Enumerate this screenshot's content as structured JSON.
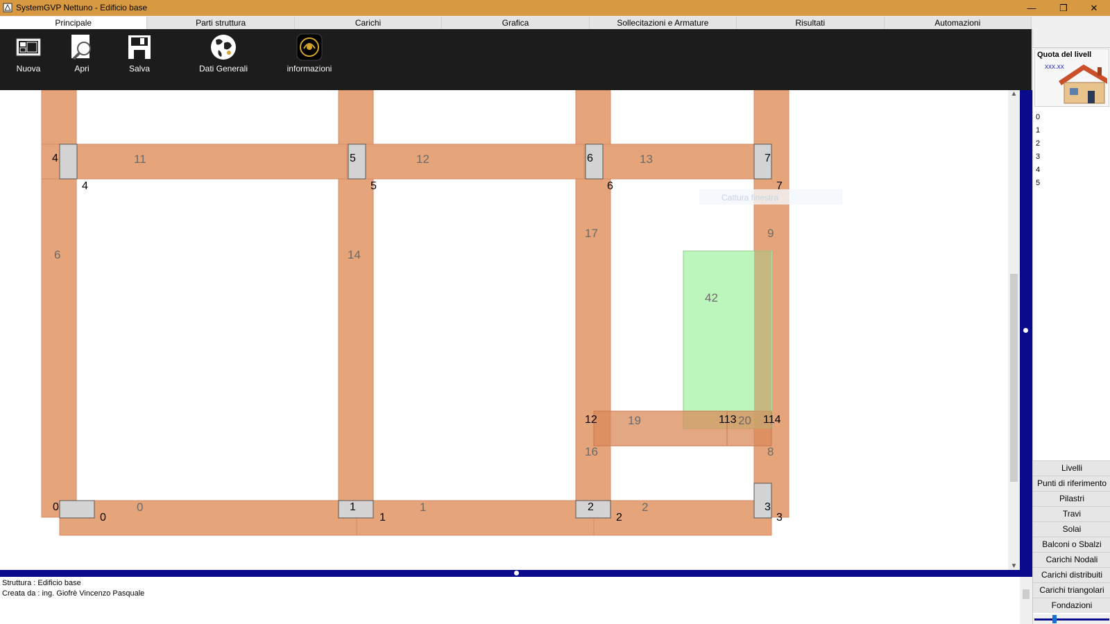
{
  "window": {
    "title": "SystemGVP Nettuno - Edificio base",
    "minimize": "—",
    "maximize": "❐",
    "close": "✕"
  },
  "tabs": [
    "Principale",
    "Parti struttura",
    "Carichi",
    "Grafica",
    "Sollecitazioni e Armature",
    "Risultati",
    "Automazioni"
  ],
  "active_tab": "Principale",
  "toolbar": {
    "nuova": "Nuova",
    "apri": "Apri",
    "salva": "Salva",
    "dati_generali": "Dati Generali",
    "informazioni": "informazioni"
  },
  "drawing": {
    "beam_labels": {
      "b11": "11",
      "b12": "12",
      "b13": "13",
      "b6": "6",
      "b14": "14",
      "b17": "17",
      "b9": "9",
      "b16": "16",
      "b8": "8",
      "b19": "19",
      "b20": "20",
      "b0": "0",
      "b1": "1",
      "b2": "2"
    },
    "node_labels": {
      "n4": "4",
      "n5": "5",
      "n6": "6",
      "n7": "7",
      "n0": "0",
      "n1": "1",
      "n2": "2",
      "n3": "3",
      "n12": "12",
      "n113": "113",
      "n114": "114"
    },
    "pillar_labels": {
      "p4": "4",
      "p5": "5",
      "p6": "6",
      "p7": "7",
      "p0": "0",
      "p1": "1",
      "p2": "2",
      "p3": "3"
    },
    "slab_label": "42",
    "capture_tooltip": "Cattura finestra",
    "colors": {
      "beam": "#e5a47a",
      "beam_edge": "#d88a63",
      "pillar": "#d3d3d3",
      "slab": "#b9f5b9"
    }
  },
  "console": {
    "line1": "Struttura : Edificio base",
    "line2": "Creata da : ing. Giofrè Vincenzo Pasquale"
  },
  "right_panel": {
    "header_title": "Quota del livell",
    "header_sub": "xxx.xx",
    "levels": [
      "0",
      "1",
      "2",
      "3",
      "4",
      "5"
    ],
    "buttons": [
      "Livelli",
      "Punti di riferimento",
      "Pilastri",
      "Travi",
      "Solai",
      "Balconi o Sbalzi",
      "Carichi Nodali",
      "Carichi distribuiti",
      "Carichi triangolari",
      "Fondazioni"
    ]
  }
}
